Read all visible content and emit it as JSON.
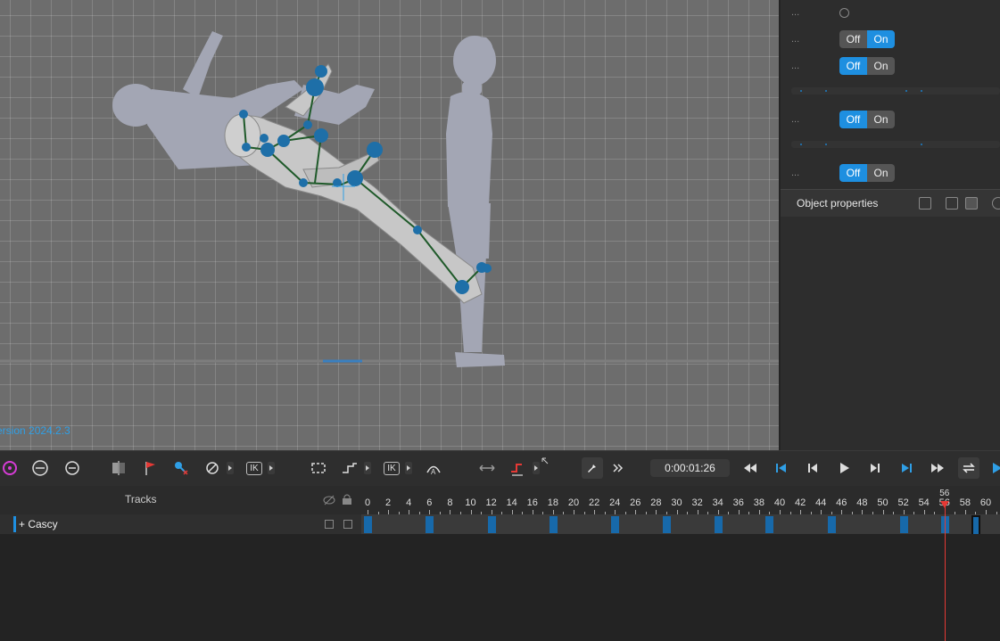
{
  "viewport": {
    "version_label": "ersion 2024.2.3"
  },
  "right_panel": {
    "rows": [
      {
        "label": "...",
        "type": "radio"
      },
      {
        "label": "...",
        "type": "toggle",
        "off": "Off",
        "on": "On",
        "state": "on"
      },
      {
        "label": "...",
        "type": "toggle",
        "off": "Off",
        "on": "On",
        "state": "off"
      },
      {
        "label": "",
        "type": "slider"
      },
      {
        "label": "...",
        "type": "toggle",
        "off": "Off",
        "on": "On",
        "state": "off"
      },
      {
        "label": "",
        "type": "slider"
      },
      {
        "label": "...",
        "type": "toggle",
        "off": "Off",
        "on": "On",
        "state": "off"
      }
    ],
    "object_properties_title": "Object properties"
  },
  "toolbar": {
    "ik_label_1": "IK",
    "ik_label_2": "IK",
    "time": "0:00:01:26"
  },
  "tracks": {
    "title": "Tracks",
    "items": [
      {
        "name": "+ Cascy"
      }
    ]
  },
  "timeline": {
    "ticks": [
      "0",
      "2",
      "4",
      "6",
      "8",
      "10",
      "12",
      "14",
      "16",
      "18",
      "20",
      "22",
      "24",
      "26",
      "28",
      "30",
      "32",
      "34",
      "36",
      "38",
      "40",
      "42",
      "44",
      "46",
      "48",
      "50",
      "52",
      "54",
      "56",
      "58",
      "60"
    ],
    "current_frame": "56",
    "keyframes": [
      0,
      6,
      12,
      18,
      24,
      29,
      34,
      39,
      45,
      52,
      56,
      59
    ]
  },
  "colors": {
    "accent": "#1e8fe0",
    "playhead": "#e53935",
    "key": "#1769aa"
  }
}
